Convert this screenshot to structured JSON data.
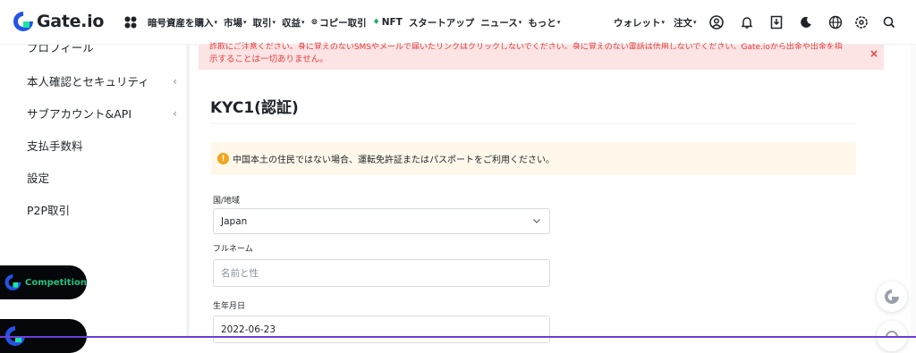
{
  "header": {
    "brand": "Gate.io",
    "nav": [
      {
        "label": "暗号資産を購入",
        "caret": true
      },
      {
        "label": "市場",
        "caret": true
      },
      {
        "label": "取引",
        "caret": true
      },
      {
        "label": "収益",
        "caret": true
      },
      {
        "label": "コピー取引",
        "caret": false,
        "icon": "copy-icon"
      },
      {
        "label": "NFT",
        "caret": false,
        "icon": "nft-icon"
      },
      {
        "label": "スタートアップ",
        "caret": false
      },
      {
        "label": "ニュース",
        "caret": true
      },
      {
        "label": "もっと",
        "caret": true
      }
    ],
    "wallet": "ウォレット",
    "orders": "注文",
    "caret": "▾"
  },
  "sidebar": {
    "partial_top": "プロフィール",
    "items": [
      {
        "label": "本人確認とセキュリティ",
        "chevron": "‹"
      },
      {
        "label": "サブアカウント&API",
        "chevron": "‹"
      },
      {
        "label": "支払手数料",
        "chevron": ""
      },
      {
        "label": "設定",
        "chevron": ""
      },
      {
        "label": "P2P取引",
        "chevron": ""
      }
    ],
    "competition": "Competition"
  },
  "alert": {
    "line1": "詐欺にご注意ください。身に覚えのないSMSやメールで届いたリンクはクリックしないでください。身に覚えのない電話は信用しないでください。Gate.ioから出金や出金を指",
    "line2": "示することは一切ありません。",
    "close": "×"
  },
  "page": {
    "title": "KYC1(認証)",
    "notice": "中国本土の住民ではない場合、運転免許証またはパスポートをご利用ください。",
    "notice_icon": "!"
  },
  "form": {
    "country_label": "国/地域",
    "country_value": "Japan",
    "fullname_label": "フルネーム",
    "fullname_placeholder": "名前と性",
    "dob_label": "生年月日",
    "dob_value": "2022-06-23"
  },
  "colors": {
    "alert_bg": "#fde4e4",
    "alert_text": "#e8393a",
    "notice_bg": "#fff8ea",
    "warn": "#f4a51c",
    "brand_blue": "#2354e6",
    "competition_green": "#27c17d"
  }
}
